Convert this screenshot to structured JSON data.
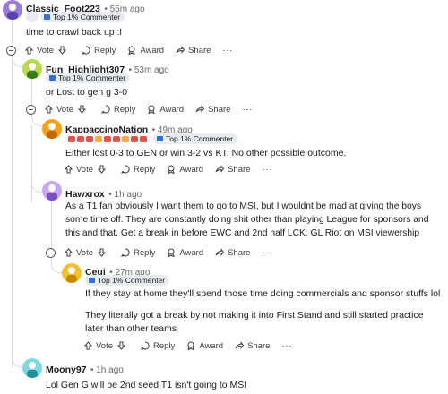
{
  "actions": {
    "vote": "Vote",
    "reply": "Reply",
    "award": "Award",
    "share": "Share",
    "more": "···"
  },
  "comments": [
    {
      "user": "Classic_Foot223",
      "time": "55m ago",
      "flair": "Top 1% Commenter",
      "body": "time to crawl back up :l",
      "avatar_color": "#9b7bd8"
    },
    {
      "user": "Fun_Highlight307",
      "time": "53m ago",
      "flair": "Top 1% Commenter",
      "body": "or Lost to gen g 3-0",
      "avatar_color": "#b7d94a"
    },
    {
      "user": "KappaccinoNation",
      "time": "49m ago",
      "flair": "Top 1% Commenter",
      "body": "Either lost 0-3 to GEN or win 3-2 vs KT. No other possible outcome.",
      "avatar_color": "#f4a21e"
    },
    {
      "user": "Hawxrox",
      "time": "1h ago",
      "flair": "",
      "body": "As a T1 fan obviously I want them to go to MSI, but I wouldnt be mad at giving the boys some time off. They are constantly doing shit other than playing League for sponsors and this and that. Get a break in before EWC and 2nd half LCK. GL Riot on MSI viewership",
      "avatar_color": "#c8a6f2"
    },
    {
      "user": "Ceui",
      "time": "27m ago",
      "flair": "Top 1% Commenter",
      "body": "If they stay at home they'll spend those time doing commercials and sponsor stuffs lol",
      "body2": "They literally got a break by not making it into First Stand and still started practice later than other teams",
      "avatar_color": "#f2c12e"
    },
    {
      "user": "Moony97",
      "time": "1h ago",
      "flair": "",
      "body": "Lol Gen G will be 2nd seed T1 isn't going to MSI",
      "avatar_color": "#7fd8e0"
    }
  ]
}
